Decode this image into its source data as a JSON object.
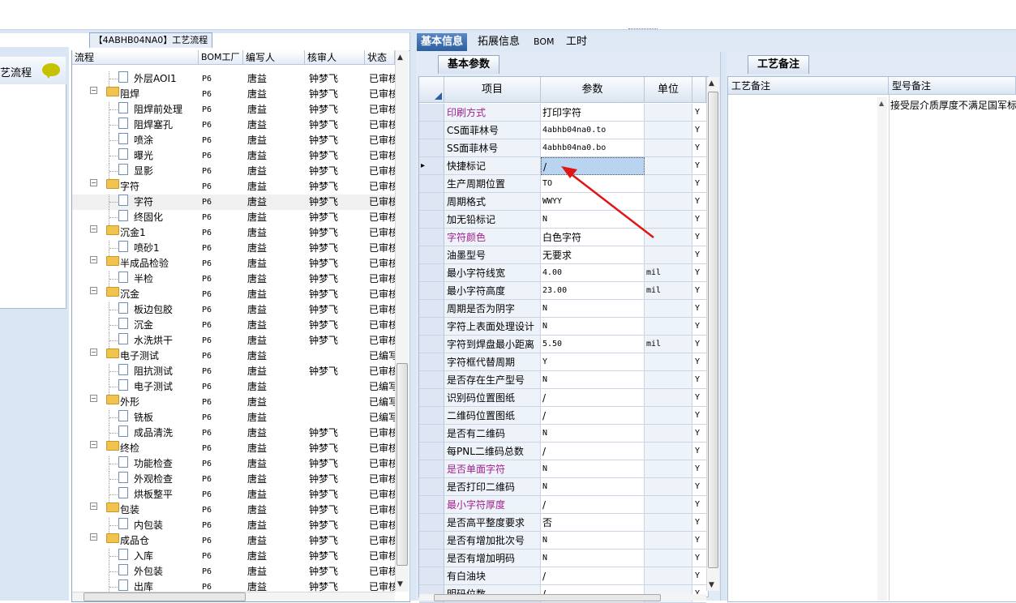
{
  "left_panel": {
    "tab_label": "【4ABHB04NA0】工艺流程",
    "header_label": "艺流程"
  },
  "tree": {
    "columns": [
      "流程",
      "BOM工厂",
      "编写人",
      "核审人",
      "状态"
    ],
    "partial_top_row": {
      "name": "...",
      "status": ""
    },
    "rows": [
      {
        "level": 2,
        "kind": "doc",
        "name": "外层AOI1",
        "bom": "P6",
        "writer": "唐益",
        "reviewer": "钟梦飞",
        "status": "已审核"
      },
      {
        "level": 1,
        "kind": "folder",
        "name": "阻焊",
        "bom": "P6",
        "writer": "唐益",
        "reviewer": "钟梦飞",
        "status": "已审核"
      },
      {
        "level": 2,
        "kind": "doc",
        "name": "阻焊前处理",
        "bom": "P6",
        "writer": "唐益",
        "reviewer": "钟梦飞",
        "status": "已审核"
      },
      {
        "level": 2,
        "kind": "doc",
        "name": "阻焊塞孔",
        "bom": "P6",
        "writer": "唐益",
        "reviewer": "钟梦飞",
        "status": "已审核"
      },
      {
        "level": 2,
        "kind": "doc",
        "name": "喷涂",
        "bom": "P6",
        "writer": "唐益",
        "reviewer": "钟梦飞",
        "status": "已审核"
      },
      {
        "level": 2,
        "kind": "doc",
        "name": "曝光",
        "bom": "P6",
        "writer": "唐益",
        "reviewer": "钟梦飞",
        "status": "已审核"
      },
      {
        "level": 2,
        "kind": "doc",
        "name": "显影",
        "bom": "P6",
        "writer": "唐益",
        "reviewer": "钟梦飞",
        "status": "已审核"
      },
      {
        "level": 1,
        "kind": "folder",
        "name": "字符",
        "bom": "P6",
        "writer": "唐益",
        "reviewer": "钟梦飞",
        "status": "已审核"
      },
      {
        "level": 2,
        "kind": "doc",
        "name": "字符",
        "bom": "P6",
        "writer": "唐益",
        "reviewer": "钟梦飞",
        "status": "已审核",
        "selected": true
      },
      {
        "level": 2,
        "kind": "doc",
        "name": "终固化",
        "bom": "P6",
        "writer": "唐益",
        "reviewer": "钟梦飞",
        "status": "已审核"
      },
      {
        "level": 1,
        "kind": "folder",
        "name": "沉金1",
        "bom": "P6",
        "writer": "唐益",
        "reviewer": "钟梦飞",
        "status": "已审核"
      },
      {
        "level": 2,
        "kind": "doc",
        "name": "喷砂1",
        "bom": "P6",
        "writer": "唐益",
        "reviewer": "钟梦飞",
        "status": "已审核"
      },
      {
        "level": 1,
        "kind": "folder",
        "name": "半成品检验",
        "bom": "P6",
        "writer": "唐益",
        "reviewer": "钟梦飞",
        "status": "已审核"
      },
      {
        "level": 2,
        "kind": "doc",
        "name": "半检",
        "bom": "P6",
        "writer": "唐益",
        "reviewer": "钟梦飞",
        "status": "已审核"
      },
      {
        "level": 1,
        "kind": "folder",
        "name": "沉金",
        "bom": "P6",
        "writer": "唐益",
        "reviewer": "钟梦飞",
        "status": "已审核"
      },
      {
        "level": 2,
        "kind": "doc",
        "name": "板边包胶",
        "bom": "P6",
        "writer": "唐益",
        "reviewer": "钟梦飞",
        "status": "已审核"
      },
      {
        "level": 2,
        "kind": "doc",
        "name": "沉金",
        "bom": "P6",
        "writer": "唐益",
        "reviewer": "钟梦飞",
        "status": "已审核"
      },
      {
        "level": 2,
        "kind": "doc",
        "name": "水洗烘干",
        "bom": "P6",
        "writer": "唐益",
        "reviewer": "钟梦飞",
        "status": "已审核"
      },
      {
        "level": 1,
        "kind": "folder",
        "name": "电子测试",
        "bom": "P6",
        "writer": "唐益",
        "reviewer": "",
        "status": "已编写"
      },
      {
        "level": 2,
        "kind": "doc",
        "name": "阻抗测试",
        "bom": "P6",
        "writer": "唐益",
        "reviewer": "钟梦飞",
        "status": "已审核"
      },
      {
        "level": 2,
        "kind": "doc",
        "name": "电子测试",
        "bom": "P6",
        "writer": "唐益",
        "reviewer": "",
        "status": "已编写"
      },
      {
        "level": 1,
        "kind": "folder",
        "name": "外形",
        "bom": "P6",
        "writer": "唐益",
        "reviewer": "",
        "status": "已编写"
      },
      {
        "level": 2,
        "kind": "doc",
        "name": "铣板",
        "bom": "P6",
        "writer": "唐益",
        "reviewer": "",
        "status": "已编写"
      },
      {
        "level": 2,
        "kind": "doc",
        "name": "成品清洗",
        "bom": "P6",
        "writer": "唐益",
        "reviewer": "钟梦飞",
        "status": "已审核"
      },
      {
        "level": 1,
        "kind": "folder",
        "name": "终检",
        "bom": "P6",
        "writer": "唐益",
        "reviewer": "钟梦飞",
        "status": "已审核"
      },
      {
        "level": 2,
        "kind": "doc",
        "name": "功能检查",
        "bom": "P6",
        "writer": "唐益",
        "reviewer": "钟梦飞",
        "status": "已审核"
      },
      {
        "level": 2,
        "kind": "doc",
        "name": "外观检查",
        "bom": "P6",
        "writer": "唐益",
        "reviewer": "钟梦飞",
        "status": "已审核"
      },
      {
        "level": 2,
        "kind": "doc",
        "name": "烘板整平",
        "bom": "P6",
        "writer": "唐益",
        "reviewer": "钟梦飞",
        "status": "已审核"
      },
      {
        "level": 1,
        "kind": "folder",
        "name": "包装",
        "bom": "P6",
        "writer": "唐益",
        "reviewer": "钟梦飞",
        "status": "已审核"
      },
      {
        "level": 2,
        "kind": "doc",
        "name": "内包装",
        "bom": "P6",
        "writer": "唐益",
        "reviewer": "钟梦飞",
        "status": "已审核"
      },
      {
        "level": 1,
        "kind": "folder",
        "name": "成品仓",
        "bom": "P6",
        "writer": "唐益",
        "reviewer": "钟梦飞",
        "status": "已审核"
      },
      {
        "level": 2,
        "kind": "doc",
        "name": "入库",
        "bom": "P6",
        "writer": "唐益",
        "reviewer": "钟梦飞",
        "status": "已审核"
      },
      {
        "level": 2,
        "kind": "doc",
        "name": "外包装",
        "bom": "P6",
        "writer": "唐益",
        "reviewer": "钟梦飞",
        "status": "已审核"
      },
      {
        "level": 2,
        "kind": "doc",
        "name": "出库",
        "bom": "P6",
        "writer": "唐益",
        "reviewer": "钟梦飞",
        "status": "已审核"
      }
    ]
  },
  "main_tabs": [
    {
      "label": "基本信息",
      "active": true
    },
    {
      "label": "拓展信息",
      "active": false
    },
    {
      "label": "BOM",
      "active": false
    },
    {
      "label": "工时",
      "active": false
    }
  ],
  "basic_params": {
    "subtab_label": "基本参数",
    "columns": {
      "item": "项目",
      "param": "参数",
      "unit": "单位"
    },
    "rows": [
      {
        "item": "印刷方式",
        "value": "打印字符",
        "unit": "",
        "flag": "Y",
        "highlight": true
      },
      {
        "item": "CS面菲林号",
        "value": "4abhb04na0.to",
        "unit": "",
        "flag": "Y",
        "mono": true
      },
      {
        "item": "SS面菲林号",
        "value": "4abhb04na0.bo",
        "unit": "",
        "flag": "Y",
        "mono": true
      },
      {
        "item": "快捷标记",
        "value": "/",
        "unit": "",
        "flag": "Y",
        "current": true
      },
      {
        "item": "生产周期位置",
        "value": "TO",
        "unit": "",
        "flag": "Y",
        "mono": true
      },
      {
        "item": "周期格式",
        "value": "WWYY",
        "unit": "",
        "flag": "Y",
        "mono": true
      },
      {
        "item": "加无铅标记",
        "value": "N",
        "unit": "",
        "flag": "Y",
        "mono": true
      },
      {
        "item": "字符颜色",
        "value": "白色字符",
        "unit": "",
        "flag": "Y",
        "highlight": true
      },
      {
        "item": "油墨型号",
        "value": "无要求",
        "unit": "",
        "flag": "Y"
      },
      {
        "item": "最小字符线宽",
        "value": "4.00",
        "unit": "mil",
        "flag": "Y",
        "mono": true
      },
      {
        "item": "最小字符高度",
        "value": "23.00",
        "unit": "mil",
        "flag": "Y",
        "mono": true
      },
      {
        "item": "周期是否为阴字",
        "value": "N",
        "unit": "",
        "flag": "Y",
        "mono": true
      },
      {
        "item": "字符上表面处理设计",
        "value": "N",
        "unit": "",
        "flag": "Y",
        "mono": true
      },
      {
        "item": "字符到焊盘最小距离",
        "value": "5.50",
        "unit": "mil",
        "flag": "Y",
        "mono": true
      },
      {
        "item": "字符框代替周期",
        "value": "Y",
        "unit": "",
        "flag": "Y",
        "mono": true
      },
      {
        "item": "是否存在生产型号",
        "value": "N",
        "unit": "",
        "flag": "Y",
        "mono": true
      },
      {
        "item": "识别码位置图纸",
        "value": "/",
        "unit": "",
        "flag": "Y"
      },
      {
        "item": "二维码位置图纸",
        "value": "/",
        "unit": "",
        "flag": "Y"
      },
      {
        "item": "是否有二维码",
        "value": "N",
        "unit": "",
        "flag": "Y",
        "mono": true
      },
      {
        "item": "每PNL二维码总数",
        "value": "/",
        "unit": "",
        "flag": "Y"
      },
      {
        "item": "是否单面字符",
        "value": "N",
        "unit": "",
        "flag": "Y",
        "mono": true,
        "highlight": true
      },
      {
        "item": "是否打印二维码",
        "value": "N",
        "unit": "",
        "flag": "Y",
        "mono": true
      },
      {
        "item": "最小字符厚度",
        "value": "/",
        "unit": "",
        "flag": "Y",
        "highlight": true
      },
      {
        "item": "是否高平整度要求",
        "value": "否",
        "unit": "",
        "flag": "Y"
      },
      {
        "item": "是否有增加批次号",
        "value": "N",
        "unit": "",
        "flag": "Y",
        "mono": true
      },
      {
        "item": "是否有增加明码",
        "value": "N",
        "unit": "",
        "flag": "Y",
        "mono": true
      },
      {
        "item": "有白油块",
        "value": "/",
        "unit": "",
        "flag": "Y"
      },
      {
        "item": "明码位数",
        "value": "/",
        "unit": "",
        "flag": "Y"
      }
    ]
  },
  "process_notes": {
    "subtab_label": "工艺备注",
    "columns": [
      "工艺备注",
      "型号备注"
    ],
    "model_note": "接受层介质厚度不满足国军标"
  },
  "colors": {
    "accent_tab": "#2d5e9f",
    "highlight_item": "#a0208e",
    "arrow": "#e01515"
  }
}
